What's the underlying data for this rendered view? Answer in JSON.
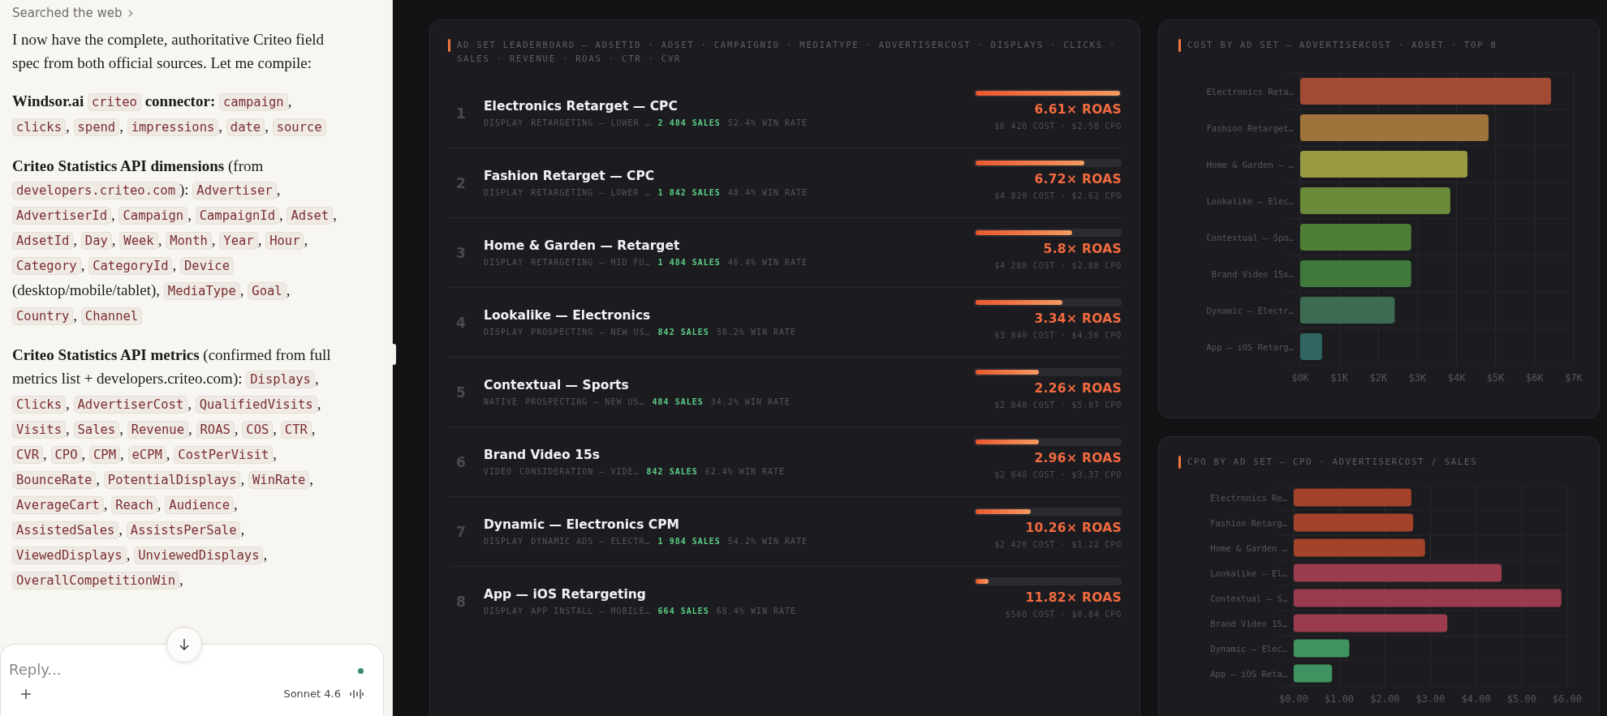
{
  "chat": {
    "breadcrumb": "Searched the web",
    "paragraphs": [
      {
        "parts": [
          {
            "kind": "text",
            "text": "I now have the complete, authoritative Criteo field spec from both official sources. Let me compile:"
          }
        ]
      },
      {
        "parts": [
          {
            "kind": "bold",
            "text": "Windsor.ai "
          },
          {
            "kind": "codes",
            "items": [
              "criteo"
            ]
          },
          {
            "kind": "bold",
            "text": " connector: "
          },
          {
            "kind": "codes",
            "separator": ",",
            "items": [
              "campaign",
              "clicks",
              "spend",
              "impressions",
              "date",
              "source"
            ]
          }
        ]
      },
      {
        "parts": [
          {
            "kind": "bold",
            "text": "Criteo Statistics API dimensions"
          },
          {
            "kind": "text",
            "text": " (from "
          },
          {
            "kind": "codes",
            "items": [
              "developers.criteo.com"
            ]
          },
          {
            "kind": "text",
            "text": "): "
          },
          {
            "kind": "codes",
            "separator": ",",
            "items": [
              "Advertiser",
              "AdvertiserId",
              "Campaign",
              "CampaignId",
              "Adset",
              "AdsetId",
              "Day",
              "Week",
              "Month",
              "Year",
              "Hour",
              "Category",
              "CategoryId"
            ]
          },
          {
            "kind": "text",
            "text": ", "
          },
          {
            "kind": "codes",
            "items": [
              "Device"
            ]
          },
          {
            "kind": "text",
            "text": " (desktop/mobile/tablet), "
          },
          {
            "kind": "codes",
            "separator": ",",
            "items": [
              "MediaType",
              "Goal",
              "Country",
              "Channel"
            ]
          }
        ]
      },
      {
        "parts": [
          {
            "kind": "bold",
            "text": "Criteo Statistics API metrics"
          },
          {
            "kind": "text",
            "text": " (confirmed from full metrics list + developers.criteo.com): "
          },
          {
            "kind": "codes",
            "separator": ",",
            "items": [
              "Displays",
              "Clicks",
              "AdvertiserCost",
              "QualifiedVisits",
              "Visits",
              "Sales",
              "Revenue",
              "ROAS",
              "COS",
              "CTR",
              "CVR",
              "CPO",
              "CPM",
              "eCPM",
              "CostPerVisit",
              "BounceRate",
              "PotentialDisplays",
              "WinRate",
              "AverageCart",
              "Reach",
              "Audience",
              "AssistedSales",
              "AssistsPerSale",
              "ViewedDisplays",
              "UnviewedDisplays",
              "OverallCompetitionWin"
            ]
          },
          {
            "kind": "text",
            "text": ","
          }
        ]
      }
    ]
  },
  "reply": {
    "placeholder": "Reply...",
    "model": "Sonnet 4.6"
  },
  "leaderboard": {
    "title": "AD SET LEADERBOARD — ADSETID · ADSET · CAMPAIGNID · MEDIATYPE · ADVERTISERCOST · DISPLAYS · CLICKS · SALES · REVENUE · ROAS · CTR · CVR",
    "rows": [
      {
        "rank": "1",
        "name": "Electronics Retarget — CPC",
        "media": "DISPLAY",
        "goal": "RETARGETING — LOWER …",
        "sales": "2 484 SALES",
        "win_rate": "52.4% WIN RATE",
        "level": 1.0,
        "roas": "6.61× ROAS",
        "cost": "$6 420 COST · $2.58 CPO"
      },
      {
        "rank": "2",
        "name": "Fashion Retarget — CPC",
        "media": "DISPLAY",
        "goal": "RETARGETING — LOWER …",
        "sales": "1 842 SALES",
        "win_rate": "48.4% WIN RATE",
        "level": 0.75,
        "roas": "6.72× ROAS",
        "cost": "$4 820 COST · $2.62 CPO"
      },
      {
        "rank": "3",
        "name": "Home & Garden — Retarget",
        "media": "DISPLAY",
        "goal": "RETARGETING — MID FU…",
        "sales": "1 484 SALES",
        "win_rate": "46.4% WIN RATE",
        "level": 0.67,
        "roas": "5.8× ROAS",
        "cost": "$4 280 COST · $2.88 CPO"
      },
      {
        "rank": "4",
        "name": "Lookalike — Electronics",
        "media": "DISPLAY",
        "goal": "PROSPECTING — NEW US…",
        "sales": "842 SALES",
        "win_rate": "38.2% WIN RATE",
        "level": 0.6,
        "roas": "3.34× ROAS",
        "cost": "$3 840 COST · $4.56 CPO"
      },
      {
        "rank": "5",
        "name": "Contextual — Sports",
        "media": "NATIVE",
        "goal": "PROSPECTING — NEW US…",
        "sales": "484 SALES",
        "win_rate": "34.2% WIN RATE",
        "level": 0.44,
        "roas": "2.26× ROAS",
        "cost": "$2 840 COST · $5.87 CPO"
      },
      {
        "rank": "6",
        "name": "Brand Video 15s",
        "media": "VIDEO",
        "goal": "CONSIDERATION — VIDE…",
        "sales": "842 SALES",
        "win_rate": "62.4% WIN RATE",
        "level": 0.44,
        "roas": "2.96× ROAS",
        "cost": "$2 840 COST · $3.37 CPO"
      },
      {
        "rank": "7",
        "name": "Dynamic — Electronics CPM",
        "media": "DISPLAY",
        "goal": "DYNAMIC ADS — ELECTR…",
        "sales": "1 984 SALES",
        "win_rate": "54.2% WIN RATE",
        "level": 0.38,
        "roas": "10.26× ROAS",
        "cost": "$2 420 COST · $1.22 CPO"
      },
      {
        "rank": "8",
        "name": "App — iOS Retargeting",
        "media": "DISPLAY",
        "goal": "APP INSTALL — MOBILE…",
        "sales": "664 SALES",
        "win_rate": "68.4% WIN RATE",
        "level": 0.09,
        "roas": "11.82× ROAS",
        "cost": "$560 COST · $0.84 CPO"
      }
    ]
  },
  "cost_chart": {
    "title": "COST BY AD SET — ADVERTISERCOST · ADSET · TOP 8",
    "chart_data": {
      "type": "bar",
      "orientation": "horizontal",
      "categories": [
        "Electronics Reta…",
        "Fashion Retarget…",
        "Home & Garden — …",
        "Lookalike — Elec…",
        "Contextual — Spo…",
        "Brand Video 15s…",
        "Dynamic — Electr…",
        "App — iOS Retarg…"
      ],
      "values": [
        6420,
        4820,
        4280,
        3840,
        2840,
        2840,
        2420,
        560
      ],
      "grid": true,
      "colors": [
        "#a34a35",
        "#a0733a",
        "#9a9a42",
        "#6a8c3a",
        "#4e7f35",
        "#3f7a3c",
        "#3b6b50",
        "#2f6660"
      ],
      "xlim": [
        0,
        7000
      ],
      "xticks": [
        {
          "value": 0,
          "label": "$0K"
        },
        {
          "value": 1000,
          "label": "$1K"
        },
        {
          "value": 2000,
          "label": "$2K"
        },
        {
          "value": 3000,
          "label": "$3K"
        },
        {
          "value": 4000,
          "label": "$4K"
        },
        {
          "value": 5000,
          "label": "$5K"
        },
        {
          "value": 6000,
          "label": "$6K"
        },
        {
          "value": 7000,
          "label": "$7K"
        }
      ]
    }
  },
  "cpo_chart": {
    "title": "CPO BY AD SET — CPO · ADVERTISERCOST / SALES",
    "chart_data": {
      "type": "bar",
      "orientation": "horizontal",
      "categories": [
        "Electronics Re…",
        "Fashion Retarg…",
        "Home & Garden …",
        "Lookalike — El…",
        "Contextual — S…",
        "Brand Video 15…",
        "Dynamic — Elec…",
        "App — iOS Reta…"
      ],
      "values": [
        2.58,
        2.62,
        2.88,
        4.56,
        5.87,
        3.37,
        1.22,
        0.84
      ],
      "grid": true,
      "colors": [
        "#a3432a",
        "#a3432a",
        "#a3432a",
        "#9a3c4d",
        "#9a3c4d",
        "#9a3c4d",
        "#3f9360",
        "#3f9360"
      ],
      "xlim": [
        0,
        6
      ],
      "xticks": [
        {
          "value": 0,
          "label": "$0.00"
        },
        {
          "value": 1,
          "label": "$1.00"
        },
        {
          "value": 2,
          "label": "$2.00"
        },
        {
          "value": 3,
          "label": "$3.00"
        },
        {
          "value": 4,
          "label": "$4.00"
        },
        {
          "value": 5,
          "label": "$5.00"
        },
        {
          "value": 6,
          "label": "$6.00"
        }
      ]
    }
  }
}
